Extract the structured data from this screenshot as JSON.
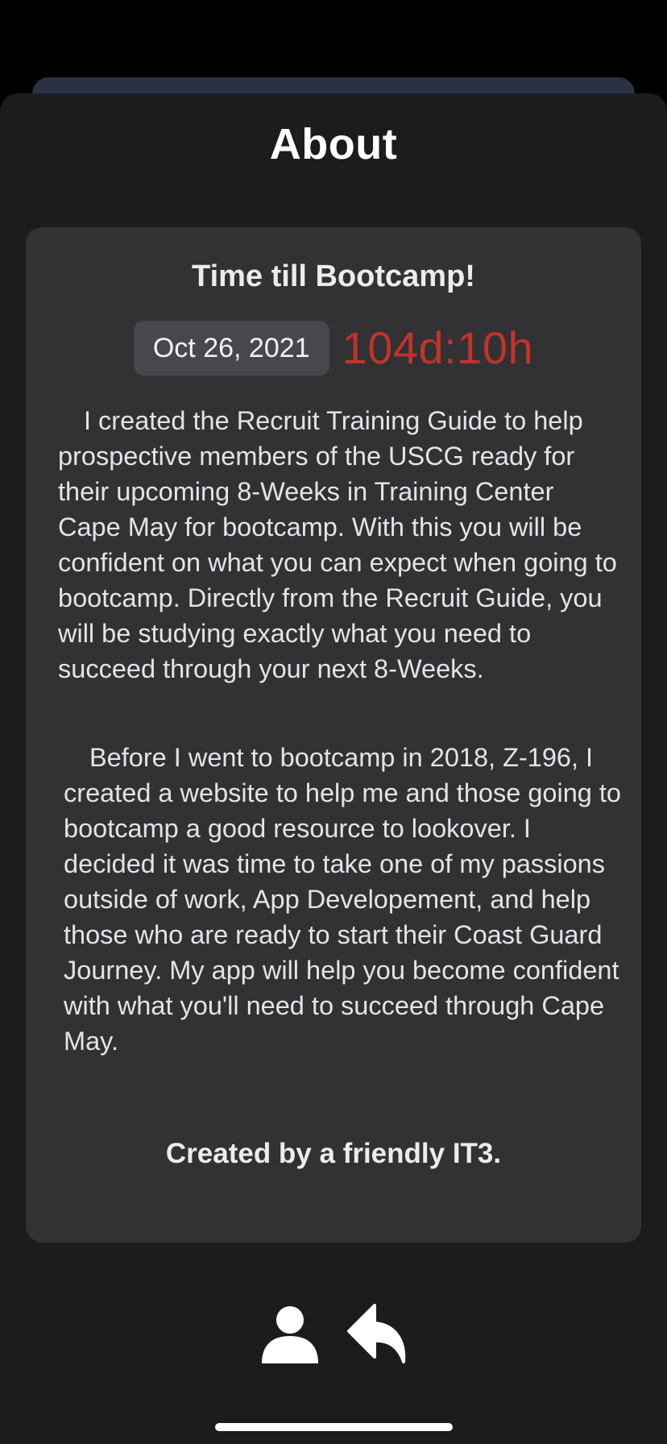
{
  "header": {
    "title": "About"
  },
  "card": {
    "heading": "Time till Bootcamp!",
    "date": "Oct 26, 2021",
    "countdown": "104d:10h",
    "paragraphs": [
      "I created the Recruit Training Guide to help prospective members of the USCG ready for their upcoming 8-Weeks in Training Center Cape May for bootcamp. With this you will be confident on what you can expect when going to bootcamp. Directly from the Recruit Guide, you will be studying exactly what you need to succeed through your next 8-Weeks.",
      "Before I went to bootcamp in 2018, Z-196, I created a website to help me and those going to bootcamp a good resource to lookover. I decided it was time to take one of my passions outside of work, App Developement, and help those who are ready to start their Coast Guard Journey. My app will help you become confident with what you'll need to succeed through Cape May."
    ],
    "signature": "Created by a friendly IT3."
  },
  "toolbar": {
    "icons": [
      "person-icon",
      "reply-arrow-icon"
    ]
  },
  "colors": {
    "background": "#1c1c1e",
    "card": "#323235",
    "countdown": "#c0342b",
    "date_pill": "#48484c",
    "behind_card": "#2a3142"
  }
}
